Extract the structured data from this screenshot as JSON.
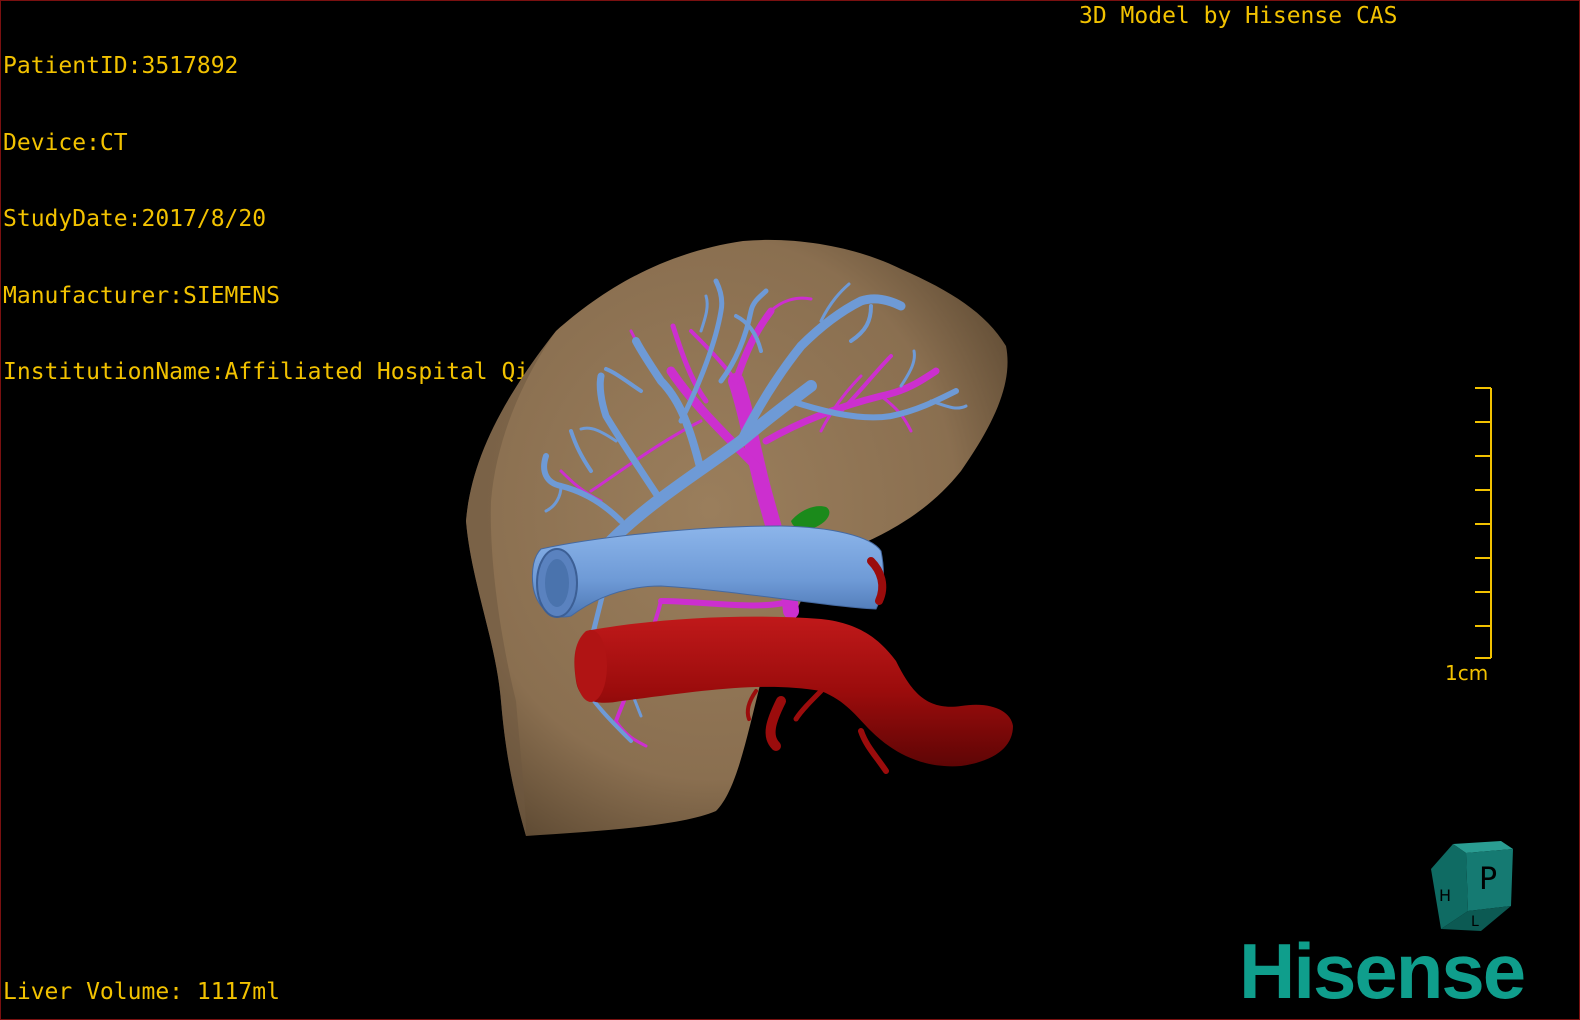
{
  "overlay": {
    "patient_id": "PatientID:3517892",
    "device": "Device:CT",
    "study_date": "StudyDate:2017/8/20",
    "manufacturer": "Manufacturer:SIEMENS",
    "institution": "InstitutionName:Affiliated Hospital Qingdao University-C",
    "model_credit": "3D Model by Hisense CAS",
    "liver_volume": "Liver Volume: 1117ml"
  },
  "scale_bar": {
    "label": "1cm"
  },
  "orientation_cube": {
    "front_face": "P",
    "side_face": "H",
    "bottom_face": "L"
  },
  "logo": {
    "text": "Hisense"
  },
  "colors": {
    "overlay_text": "#f2c200",
    "liver": "#8f7556",
    "hepatic_vein": "#6e9ad6",
    "portal_vein": "#cc2fcf",
    "vena_cava": "#9b0c0c",
    "gallbladder": "#1b8a1b",
    "logo": "#0f9e8c",
    "cube": "#157a72"
  }
}
